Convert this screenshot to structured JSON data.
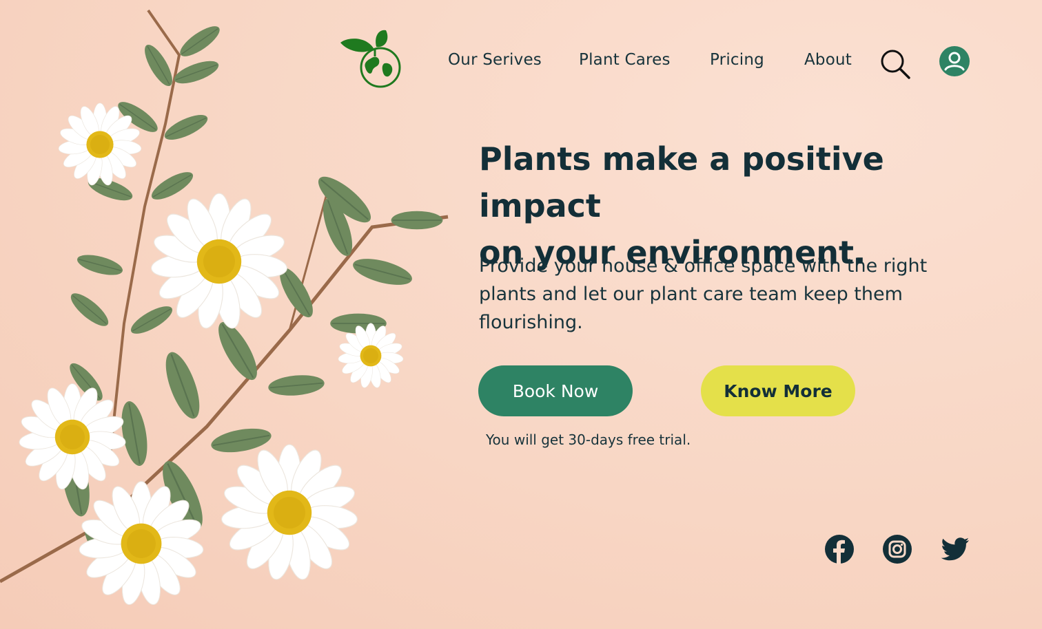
{
  "nav": {
    "logo_icon": "globe-leaf-icon",
    "items": [
      {
        "label": "Our Serives"
      },
      {
        "label": "Plant Cares"
      },
      {
        "label": "Pricing"
      },
      {
        "label": "About"
      }
    ],
    "search_icon": "search-icon",
    "avatar_icon": "user-avatar-icon"
  },
  "hero": {
    "headline_line1": "Plants make a positive impact",
    "headline_line2": "on your environment.",
    "description": "Provide your house & office space with the right plants and let our plant care team keep them flourishing.",
    "primary_button": "Book Now",
    "secondary_button": "Know More",
    "trial_note": "You will get 30-days free trial."
  },
  "social": [
    {
      "icon": "facebook-icon"
    },
    {
      "icon": "instagram-icon"
    },
    {
      "icon": "twitter-icon"
    }
  ],
  "colors": {
    "background": "#f9d9c8",
    "text_dark": "#132f38",
    "primary": "#2e8364",
    "accent": "#e4e04a",
    "logo_green": "#1f7a1f"
  }
}
